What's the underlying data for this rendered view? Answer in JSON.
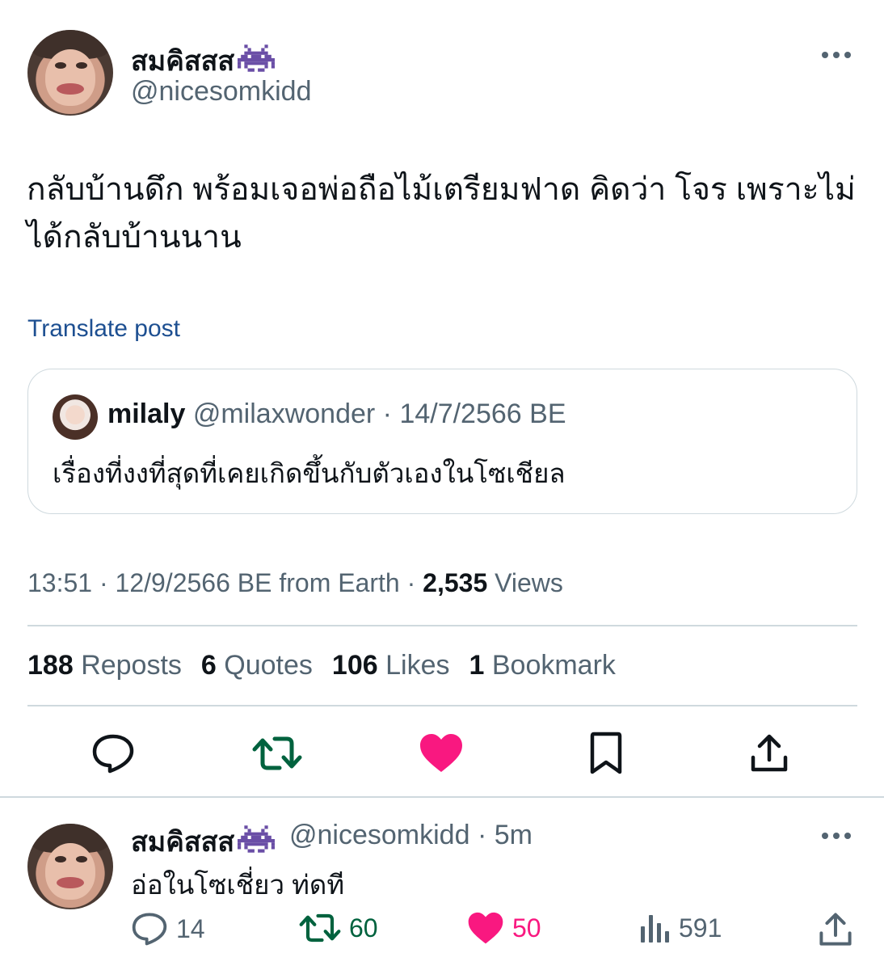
{
  "main_post": {
    "author_name": "สมคิสสส",
    "handle": "@nicesomkidd",
    "text": "กลับบ้านดึก พร้อมเจอพ่อถือไม้เตรียมฟาด คิดว่า โจร เพราะไม่ได้กลับบ้านนาน",
    "translate_label": "Translate post",
    "quote": {
      "author_name": "milaly",
      "handle": "@milaxwonder",
      "date": "· 14/7/2566 BE",
      "text": "เรื่องที่งงที่สุดที่เคยเกิดขึ้นกับตัวเองในโซเชียล"
    },
    "meta": {
      "time_date": "13:51 · 12/9/2566 BE from Earth · ",
      "views_count": "2,535",
      "views_label": " Views"
    },
    "stats": {
      "reposts_count": "188",
      "reposts_label": "Reposts",
      "quotes_count": "6",
      "quotes_label": "Quotes",
      "likes_count": "106",
      "likes_label": "Likes",
      "bookmarks_count": "1",
      "bookmarks_label": "Bookmark"
    }
  },
  "reply": {
    "author_name": "สมคิสสส",
    "handle": "@nicesomkidd",
    "time": "· 5m",
    "text": "อ่อในโซเชี่ยว ท่ดที",
    "replies": "14",
    "reposts": "60",
    "likes": "50",
    "views": "591"
  },
  "icons": {
    "emoji": "alien-monster-icon",
    "more": "more-icon",
    "reply": "reply-icon",
    "repost": "repost-icon",
    "like": "heart-icon",
    "bookmark": "bookmark-icon",
    "share": "share-icon",
    "views": "views-icon"
  },
  "colors": {
    "text": "#0f1419",
    "secondary": "#536471",
    "link": "#1d4f91",
    "repost_green": "#00623e",
    "like_pink": "#f91880",
    "border": "#cfd9de",
    "emoji_purple": "#6a4ea6"
  }
}
